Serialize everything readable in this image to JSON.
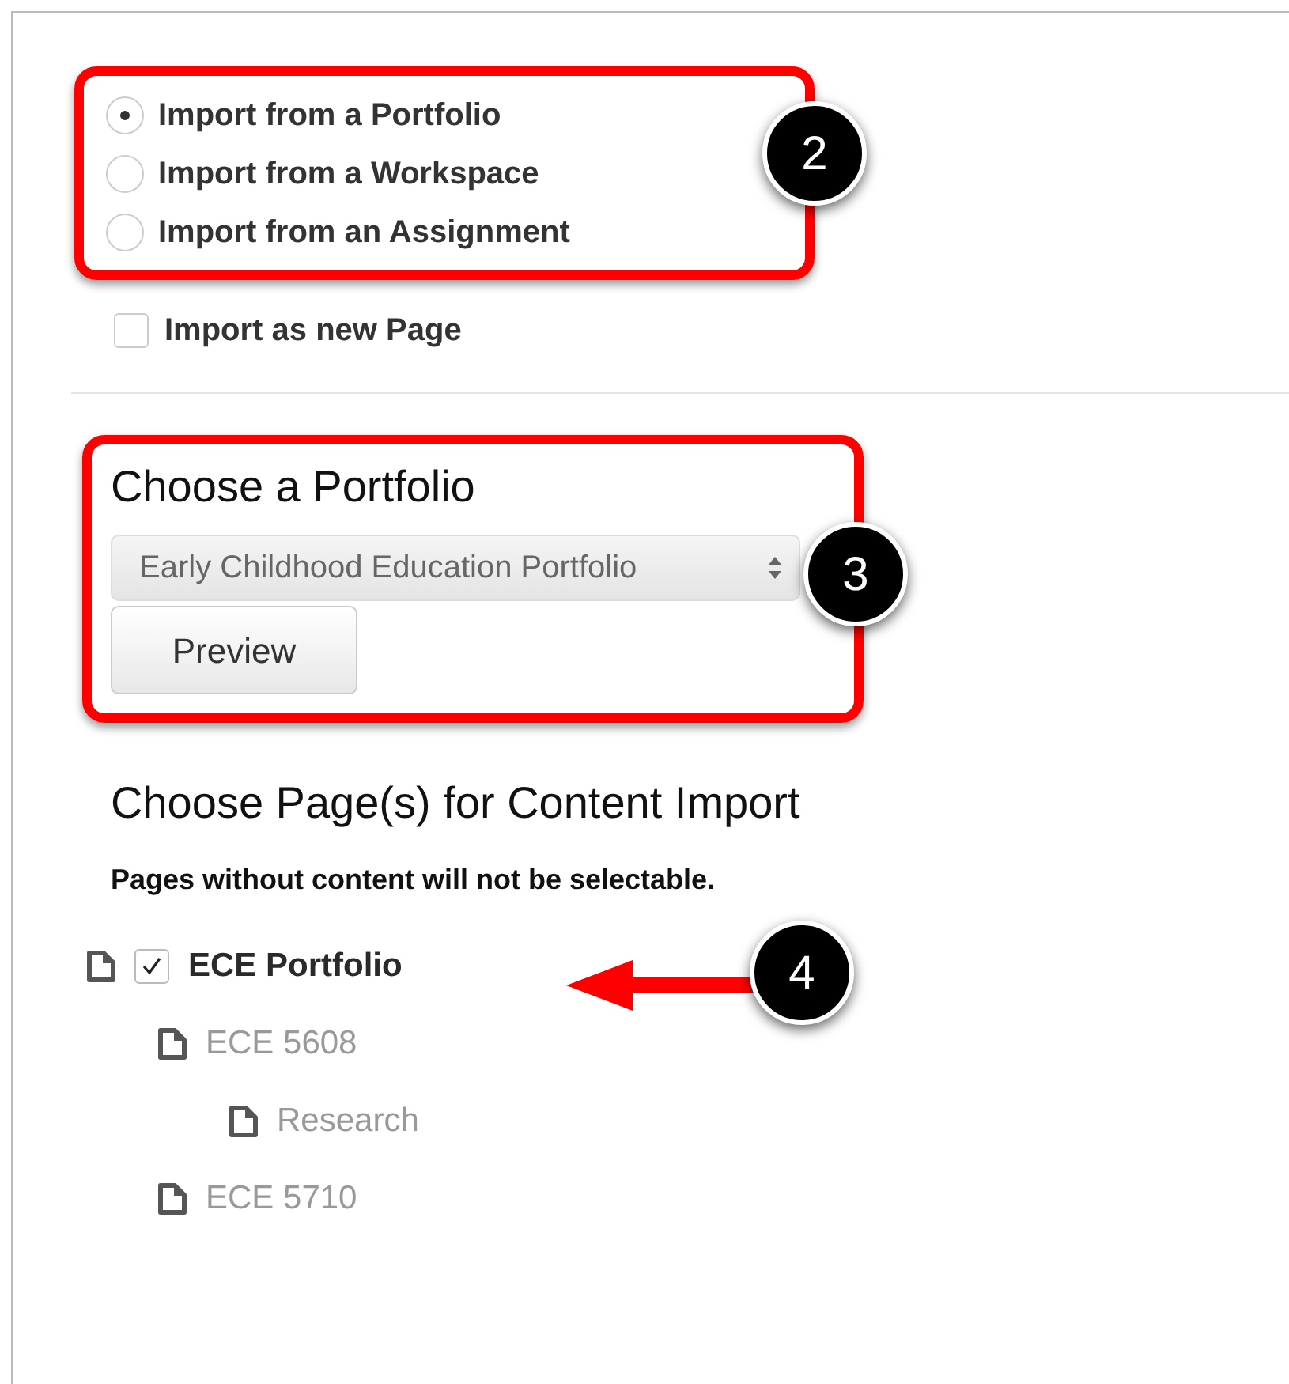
{
  "import_source": {
    "options": [
      {
        "label": "Import from a Portfolio",
        "selected": true
      },
      {
        "label": "Import from a Workspace",
        "selected": false
      },
      {
        "label": "Import from an Assignment",
        "selected": false
      }
    ]
  },
  "import_as_new_page": {
    "label": "Import as new Page",
    "checked": false
  },
  "portfolio": {
    "heading": "Choose a Portfolio",
    "select_value": "Early Childhood Education Portfolio",
    "button": "Preview"
  },
  "pages": {
    "heading": "Choose Page(s) for Content Import",
    "note": "Pages without content will not be selectable.",
    "tree": [
      {
        "label": "ECE Portfolio",
        "selectable": true,
        "checked": true,
        "children": [
          {
            "label": "ECE 5608",
            "selectable": false,
            "children": [
              {
                "label": "Research",
                "selectable": false
              }
            ]
          },
          {
            "label": "ECE 5710",
            "selectable": false
          }
        ]
      }
    ]
  },
  "callouts": [
    {
      "number": "2"
    },
    {
      "number": "3"
    },
    {
      "number": "4"
    }
  ]
}
